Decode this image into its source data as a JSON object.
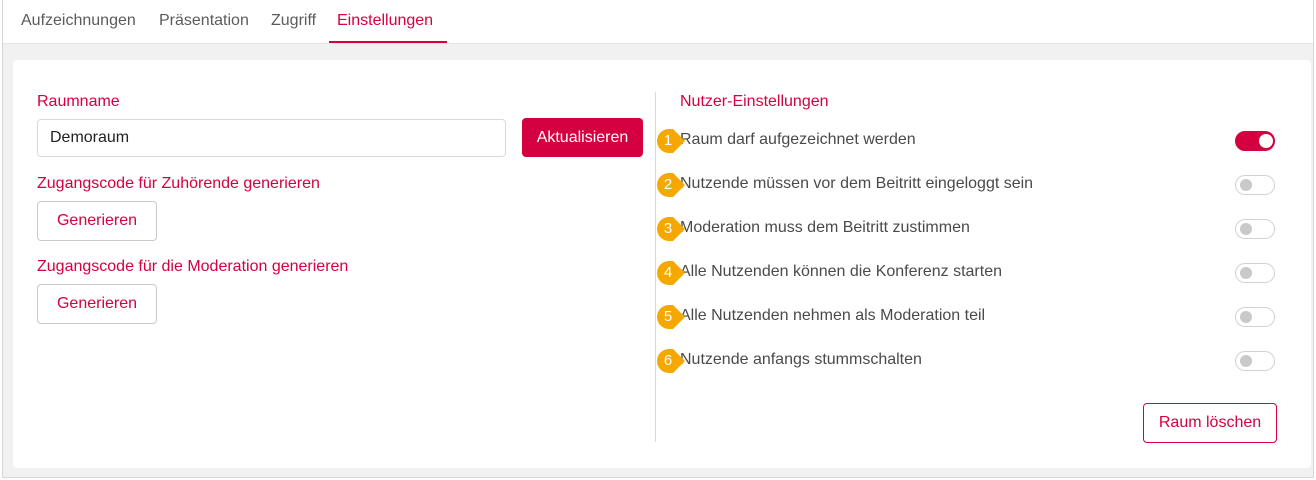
{
  "tabs": [
    {
      "label": "Aufzeichnungen",
      "active": false
    },
    {
      "label": "Präsentation",
      "active": false
    },
    {
      "label": "Zugriff",
      "active": false
    },
    {
      "label": "Einstellungen",
      "active": true
    }
  ],
  "room": {
    "name_label": "Raumname",
    "name_value": "Demoraum",
    "update_label": "Aktualisieren",
    "listener_code_label": "Zugangscode für Zuhörende generieren",
    "listener_generate_label": "Generieren",
    "moderator_code_label": "Zugangscode für die Moderation generieren",
    "moderator_generate_label": "Generieren",
    "delete_label": "Raum löschen"
  },
  "user_settings": {
    "title": "Nutzer-Einstellungen",
    "items": [
      {
        "badge": "1",
        "label": "Raum darf aufgezeichnet werden",
        "enabled": true
      },
      {
        "badge": "2",
        "label": "Nutzende müssen vor dem Beitritt eingeloggt sein",
        "enabled": false
      },
      {
        "badge": "3",
        "label": "Moderation muss dem Beitritt zustimmen",
        "enabled": false
      },
      {
        "badge": "4",
        "label": "Alle Nutzenden können die Konferenz starten",
        "enabled": false
      },
      {
        "badge": "5",
        "label": "Alle Nutzenden nehmen als Moderation teil",
        "enabled": false
      },
      {
        "badge": "6",
        "label": "Nutzende anfangs stummschalten",
        "enabled": false
      }
    ]
  },
  "colors": {
    "accent": "#d5003f",
    "badge": "#f5a800",
    "toggle_off_knob": "#c9c9c9"
  }
}
